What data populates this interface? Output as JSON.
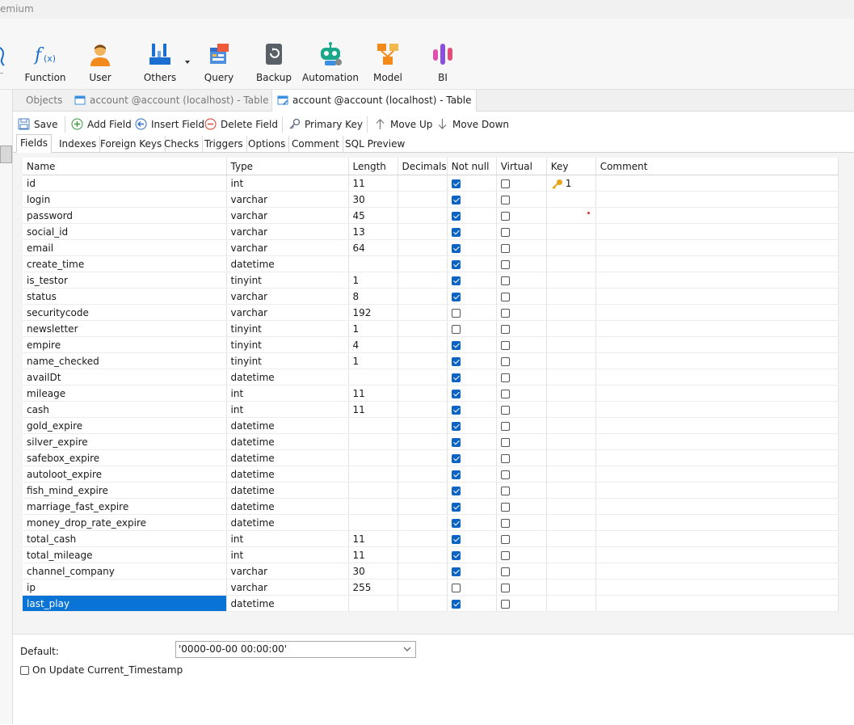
{
  "title_fragment": "emium",
  "ribbon": [
    {
      "label": "Function",
      "icon": "function-icon"
    },
    {
      "label": "User",
      "icon": "user-icon"
    },
    {
      "label": "Others",
      "icon": "others-tools-icon"
    },
    {
      "label": "Query",
      "icon": "query-icon"
    },
    {
      "label": "Backup",
      "icon": "backup-icon"
    },
    {
      "label": "Automation",
      "icon": "automation-robot-icon"
    },
    {
      "label": "Model",
      "icon": "model-icon"
    },
    {
      "label": "BI",
      "icon": "bi-icon"
    }
  ],
  "doc_tabs": {
    "objects": "Objects",
    "tab1": "account @account (localhost) - Table",
    "tab2": "account @account (localhost) - Table"
  },
  "toolbar": {
    "save": "Save",
    "add_field": "Add Field",
    "insert_field": "Insert Field",
    "delete_field": "Delete Field",
    "primary_key": "Primary Key",
    "move_up": "Move Up",
    "move_down": "Move Down"
  },
  "sub_tabs": [
    "Fields",
    "Indexes",
    "Foreign Keys",
    "Checks",
    "Triggers",
    "Options",
    "Comment",
    "SQL Preview"
  ],
  "columns": [
    "Name",
    "Type",
    "Length",
    "Decimals",
    "Not null",
    "Virtual",
    "Key",
    "Comment"
  ],
  "fields": [
    {
      "name": "id",
      "type": "int",
      "length": "11",
      "not_null": true,
      "virtual": false,
      "key": "1"
    },
    {
      "name": "login",
      "type": "varchar",
      "length": "30",
      "not_null": true,
      "virtual": false,
      "key": ""
    },
    {
      "name": "password",
      "type": "varchar",
      "length": "45",
      "not_null": true,
      "virtual": false,
      "key": ""
    },
    {
      "name": "social_id",
      "type": "varchar",
      "length": "13",
      "not_null": true,
      "virtual": false,
      "key": ""
    },
    {
      "name": "email",
      "type": "varchar",
      "length": "64",
      "not_null": true,
      "virtual": false,
      "key": ""
    },
    {
      "name": "create_time",
      "type": "datetime",
      "length": "",
      "not_null": true,
      "virtual": false,
      "key": ""
    },
    {
      "name": "is_testor",
      "type": "tinyint",
      "length": "1",
      "not_null": true,
      "virtual": false,
      "key": ""
    },
    {
      "name": "status",
      "type": "varchar",
      "length": "8",
      "not_null": true,
      "virtual": false,
      "key": ""
    },
    {
      "name": "securitycode",
      "type": "varchar",
      "length": "192",
      "not_null": false,
      "virtual": false,
      "key": ""
    },
    {
      "name": "newsletter",
      "type": "tinyint",
      "length": "1",
      "not_null": false,
      "virtual": false,
      "key": ""
    },
    {
      "name": "empire",
      "type": "tinyint",
      "length": "4",
      "not_null": true,
      "virtual": false,
      "key": ""
    },
    {
      "name": "name_checked",
      "type": "tinyint",
      "length": "1",
      "not_null": true,
      "virtual": false,
      "key": ""
    },
    {
      "name": "availDt",
      "type": "datetime",
      "length": "",
      "not_null": true,
      "virtual": false,
      "key": ""
    },
    {
      "name": "mileage",
      "type": "int",
      "length": "11",
      "not_null": true,
      "virtual": false,
      "key": ""
    },
    {
      "name": "cash",
      "type": "int",
      "length": "11",
      "not_null": true,
      "virtual": false,
      "key": ""
    },
    {
      "name": "gold_expire",
      "type": "datetime",
      "length": "",
      "not_null": true,
      "virtual": false,
      "key": ""
    },
    {
      "name": "silver_expire",
      "type": "datetime",
      "length": "",
      "not_null": true,
      "virtual": false,
      "key": ""
    },
    {
      "name": "safebox_expire",
      "type": "datetime",
      "length": "",
      "not_null": true,
      "virtual": false,
      "key": ""
    },
    {
      "name": "autoloot_expire",
      "type": "datetime",
      "length": "",
      "not_null": true,
      "virtual": false,
      "key": ""
    },
    {
      "name": "fish_mind_expire",
      "type": "datetime",
      "length": "",
      "not_null": true,
      "virtual": false,
      "key": ""
    },
    {
      "name": "marriage_fast_expire",
      "type": "datetime",
      "length": "",
      "not_null": true,
      "virtual": false,
      "key": ""
    },
    {
      "name": "money_drop_rate_expire",
      "type": "datetime",
      "length": "",
      "not_null": true,
      "virtual": false,
      "key": ""
    },
    {
      "name": "total_cash",
      "type": "int",
      "length": "11",
      "not_null": true,
      "virtual": false,
      "key": ""
    },
    {
      "name": "total_mileage",
      "type": "int",
      "length": "11",
      "not_null": true,
      "virtual": false,
      "key": ""
    },
    {
      "name": "channel_company",
      "type": "varchar",
      "length": "30",
      "not_null": true,
      "virtual": false,
      "key": ""
    },
    {
      "name": "ip",
      "type": "varchar",
      "length": "255",
      "not_null": false,
      "virtual": false,
      "key": ""
    },
    {
      "name": "last_play",
      "type": "datetime",
      "length": "",
      "not_null": true,
      "virtual": false,
      "key": ""
    }
  ],
  "selected_field": "last_play",
  "bottom": {
    "default_label": "Default:",
    "default_value": "'0000-00-00 00:00:00'",
    "on_update_label": "On Update Current_Timestamp",
    "on_update_checked": false
  },
  "colors": {
    "accent": "#0a74d6",
    "checkbox": "#0b63c4"
  }
}
